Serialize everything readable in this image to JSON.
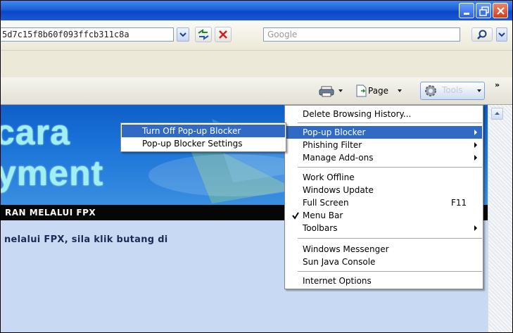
{
  "window": {
    "minimize": "minimize",
    "maximize": "restore",
    "close": "close"
  },
  "address_bar": {
    "value": "5d7c15f8b60f093ffcb311c8a",
    "search_placeholder": "Google"
  },
  "command_bar": {
    "page_label": "Page",
    "tools_label": "Tools",
    "more": "»"
  },
  "page": {
    "hero_word_1": "cara",
    "hero_word_2": "yment",
    "banner": "RAN MELALUI FPX",
    "body": "nelalui FPX, sila klik butang di"
  },
  "tools_menu": {
    "items": [
      {
        "label": "Delete Browsing History...",
        "shortcut": "",
        "submenu": false,
        "checked": false,
        "highlighted": false
      },
      {
        "label": "Pop-up Blocker",
        "shortcut": "",
        "submenu": true,
        "checked": false,
        "highlighted": true
      },
      {
        "label": "Phishing Filter",
        "shortcut": "",
        "submenu": true,
        "checked": false,
        "highlighted": false
      },
      {
        "label": "Manage Add-ons",
        "shortcut": "",
        "submenu": true,
        "checked": false,
        "highlighted": false
      },
      {
        "label": "Work Offline",
        "shortcut": "",
        "submenu": false,
        "checked": false,
        "highlighted": false
      },
      {
        "label": "Windows Update",
        "shortcut": "",
        "submenu": false,
        "checked": false,
        "highlighted": false
      },
      {
        "label": "Full Screen",
        "shortcut": "F11",
        "submenu": false,
        "checked": false,
        "highlighted": false
      },
      {
        "label": "Menu Bar",
        "shortcut": "",
        "submenu": false,
        "checked": true,
        "highlighted": false
      },
      {
        "label": "Toolbars",
        "shortcut": "",
        "submenu": true,
        "checked": false,
        "highlighted": false
      },
      {
        "label": "Windows Messenger",
        "shortcut": "",
        "submenu": false,
        "checked": false,
        "highlighted": false
      },
      {
        "label": "Sun Java Console",
        "shortcut": "",
        "submenu": false,
        "checked": false,
        "highlighted": false
      },
      {
        "label": "Internet Options",
        "shortcut": "",
        "submenu": false,
        "checked": false,
        "highlighted": false
      }
    ]
  },
  "popup_submenu": {
    "items": [
      {
        "label": "Turn Off Pop-up Blocker",
        "highlighted": true
      },
      {
        "label": "Pop-up Blocker Settings",
        "highlighted": false
      }
    ]
  },
  "colors": {
    "title_bar": "#1f5fd6",
    "menu_highlight": "#316ac5",
    "hero_text": "#9ff0f2"
  }
}
